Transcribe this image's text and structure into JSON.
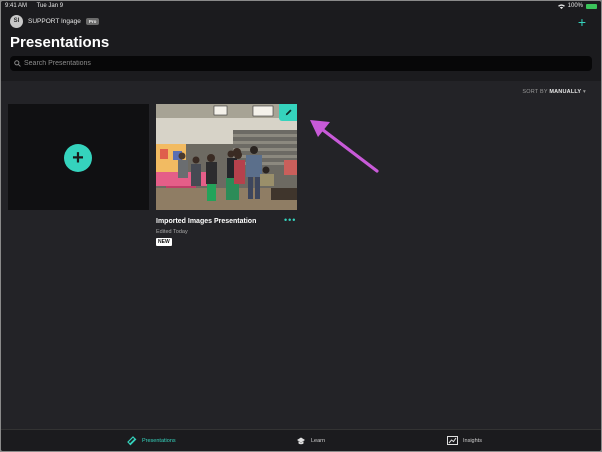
{
  "status_bar": {
    "time": "9:41 AM",
    "date": "Tue Jan 9",
    "battery": "100%"
  },
  "account": {
    "avatar_initials": "SI",
    "name": "SUPPORT Ingage",
    "plan_badge": "Pro"
  },
  "page": {
    "title": "Presentations"
  },
  "search": {
    "placeholder": "Search Presentations"
  },
  "sort": {
    "label": "SORT BY",
    "value": "MANUALLY"
  },
  "presentations": [
    {
      "title": "Imported Images Presentation",
      "subtitle": "Edited Today",
      "badge": "NEW",
      "more": "•••"
    }
  ],
  "tabs": [
    {
      "label": "Presentations",
      "icon": "presentations-logo-icon",
      "active": true
    },
    {
      "label": "Learn",
      "icon": "graduation-cap-icon",
      "active": false
    },
    {
      "label": "Insights",
      "icon": "chart-line-icon",
      "active": false
    }
  ],
  "colors": {
    "accent": "#35d3bd",
    "annotation_arrow": "#c85ad8",
    "background": "#232327"
  }
}
